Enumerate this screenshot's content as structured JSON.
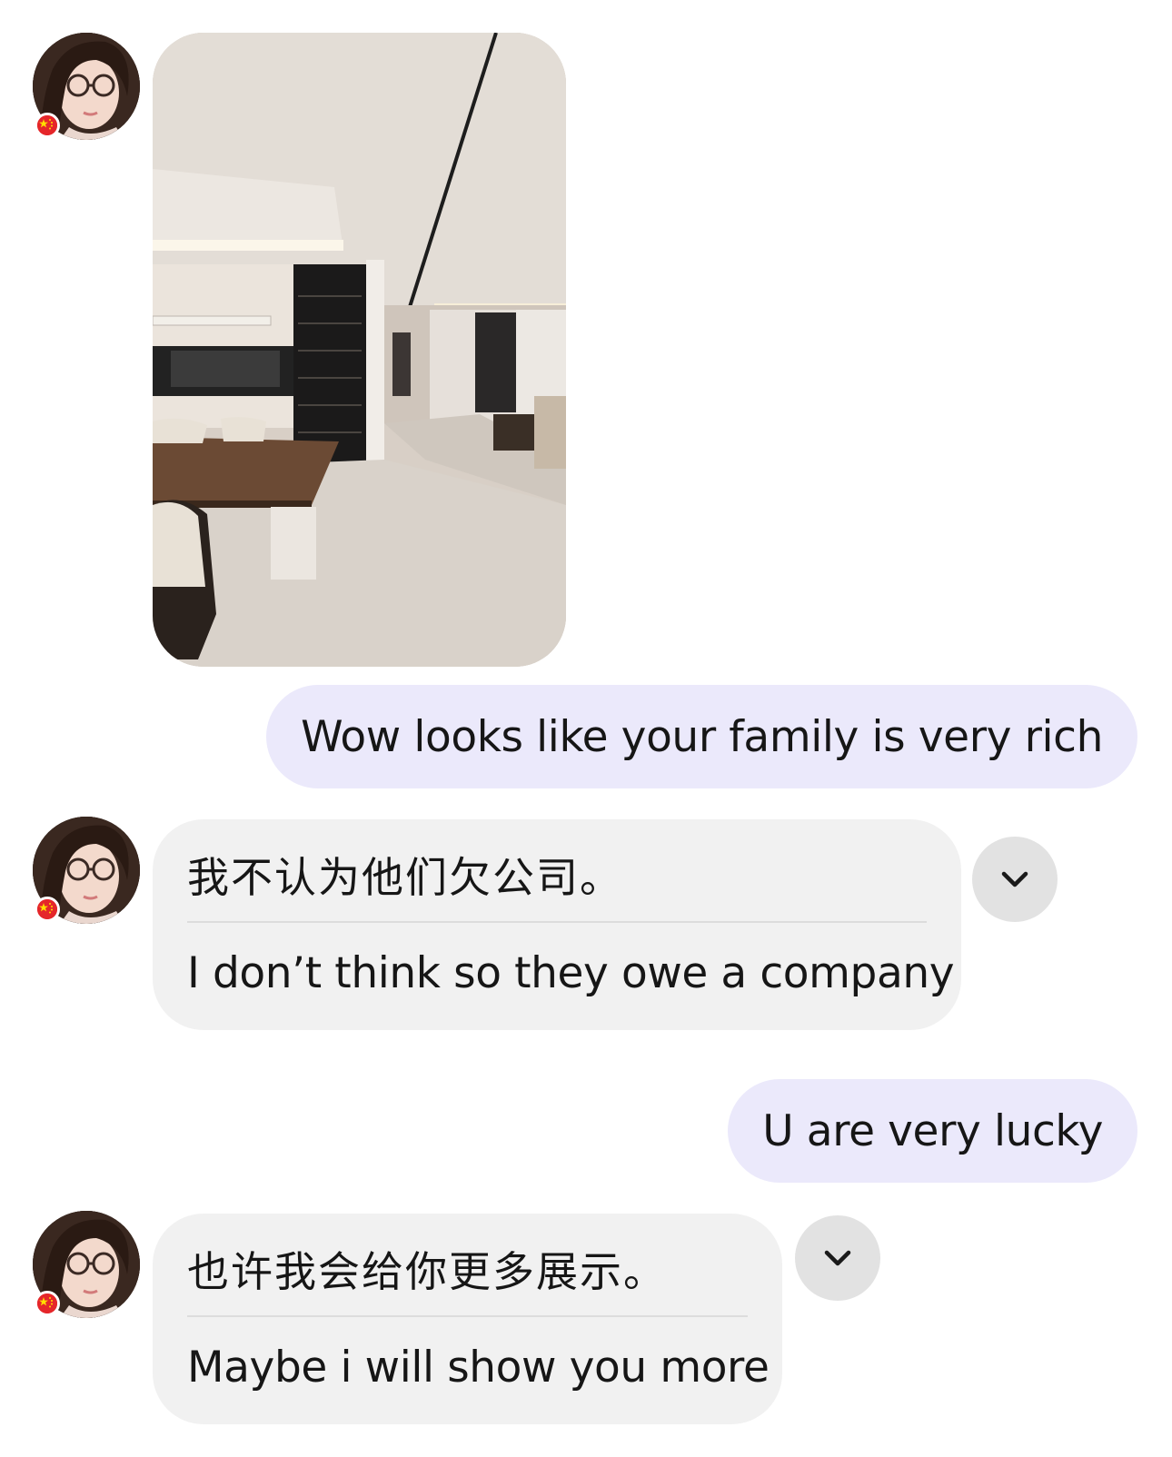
{
  "colors": {
    "outgoing_bubble": "#ebe9fb",
    "incoming_bubble": "#f1f1f1",
    "toggle_button": "#e2e2e2",
    "flag_red": "#e5262a",
    "flag_star": "#ffde00"
  },
  "icons": {
    "avatar": "avatar-photo",
    "flag": "china-flag-icon",
    "toggle": "chevron-down-icon"
  },
  "messages": [
    {
      "type": "incoming-image",
      "content": "interior-photo"
    },
    {
      "type": "outgoing",
      "text": "Wow looks like your family is very rich"
    },
    {
      "type": "incoming",
      "original": "我不认为他们欠公司。",
      "translation": "I don’t think so they owe a company"
    },
    {
      "type": "outgoing",
      "text": "U are very lucky"
    },
    {
      "type": "incoming",
      "original": "也许我会给你更多展示。",
      "translation": "Maybe i will show you more"
    }
  ]
}
